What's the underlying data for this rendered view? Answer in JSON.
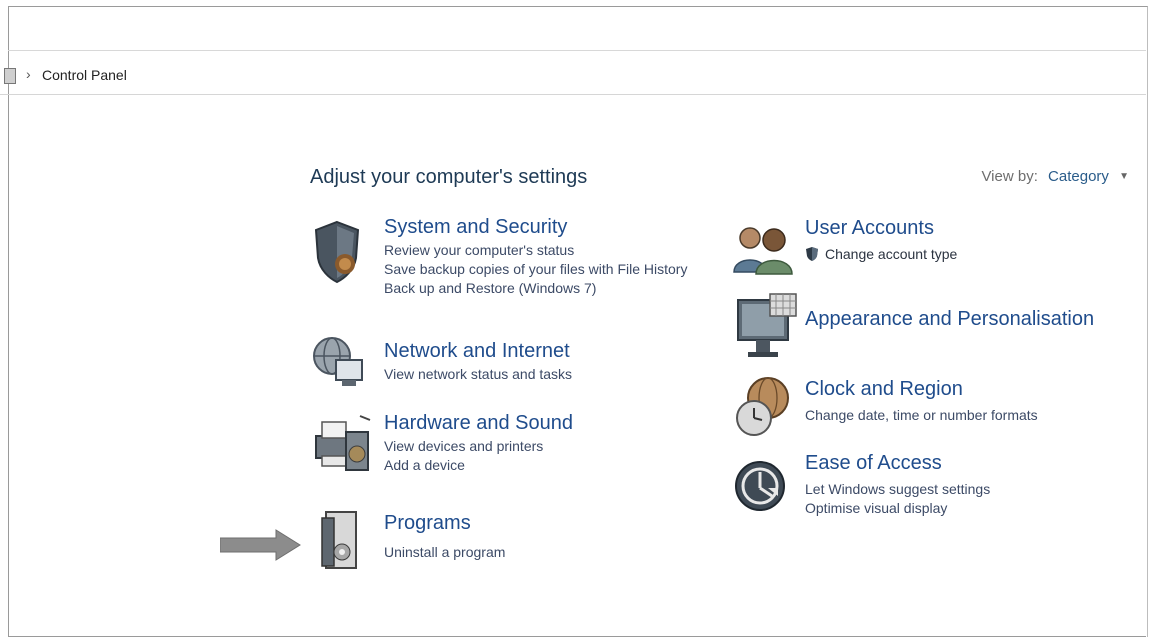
{
  "breadcrumb": {
    "separator": "›",
    "location": "Control Panel"
  },
  "page": {
    "title": "Adjust your computer's settings"
  },
  "view_by": {
    "label": "View by:",
    "value": "Category"
  },
  "left_categories": [
    {
      "title": "System and Security",
      "icon": "shield-icon",
      "links": [
        "Review your computer's status",
        "Save backup copies of your files with File History",
        "Back up and Restore (Windows 7)"
      ]
    },
    {
      "title": "Network and Internet",
      "icon": "globe-network-icon",
      "links": [
        "View network status and tasks"
      ]
    },
    {
      "title": "Hardware and Sound",
      "icon": "printer-speaker-icon",
      "links": [
        "View devices and printers",
        "Add a device"
      ]
    },
    {
      "title": "Programs",
      "icon": "programs-box-icon",
      "links": [
        "Uninstall a program"
      ]
    }
  ],
  "right_categories": [
    {
      "title": "User Accounts",
      "icon": "users-icon",
      "links": [
        "Change account type"
      ]
    },
    {
      "title": "Appearance and Personalisation",
      "icon": "monitor-icon",
      "links": []
    },
    {
      "title": "Clock and Region",
      "icon": "clock-globe-icon",
      "links": [
        "Change date, time or number formats"
      ]
    },
    {
      "title": "Ease of Access",
      "icon": "ease-of-access-icon",
      "links": [
        "Let Windows suggest settings",
        "Optimise visual display"
      ]
    }
  ],
  "colors": {
    "title_blue": "#1f4c8c",
    "link_gray": "#3c4a66",
    "arrow": "#8c8c8c"
  }
}
